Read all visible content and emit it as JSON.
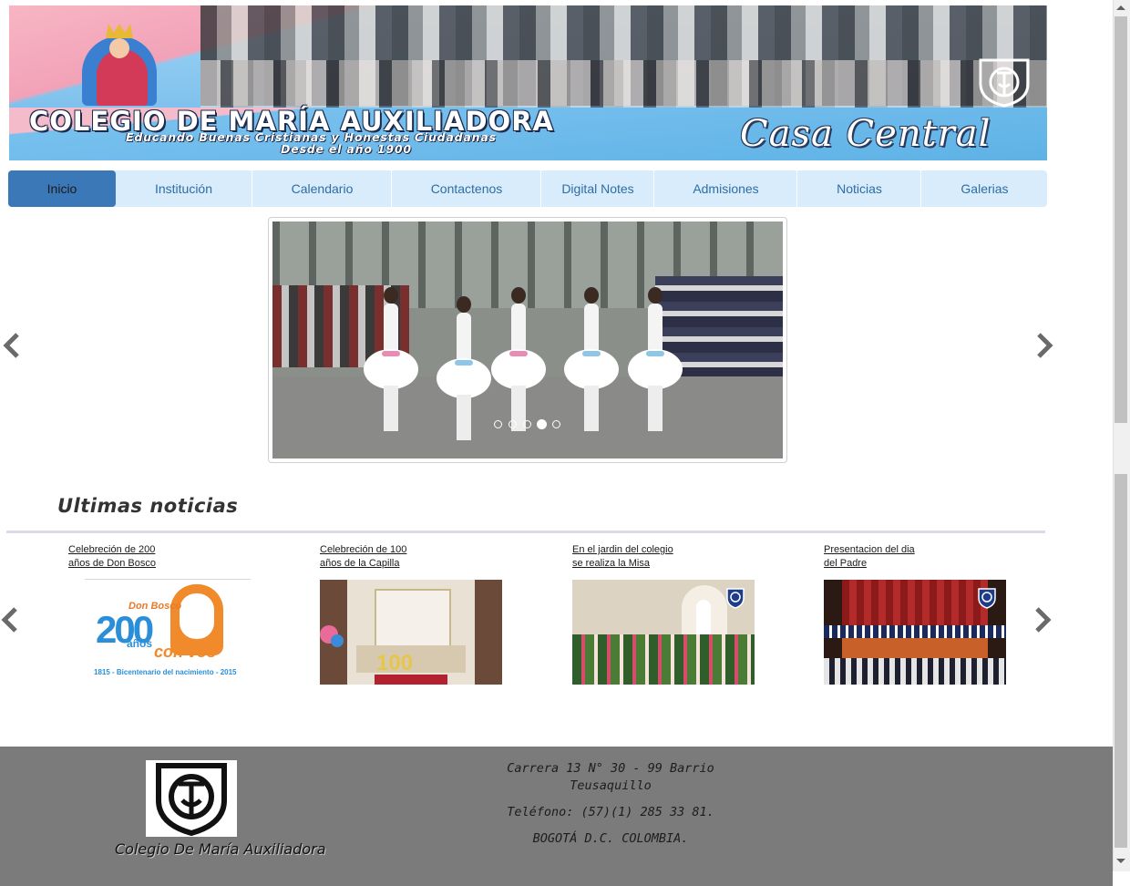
{
  "banner": {
    "title": "COLEGIO DE MARÍA AUXILIADORA",
    "tagline": "Educando Buenas Cristianas y  Honestas Ciudadanas",
    "since": "Desde el año 1900",
    "casa": "Casa Central"
  },
  "nav": {
    "items": [
      {
        "label": "Inicio",
        "active": true
      },
      {
        "label": "Institución"
      },
      {
        "label": "Calendario"
      },
      {
        "label": "Contactenos"
      },
      {
        "label": "Digital Notes"
      },
      {
        "label": "Admisiones"
      },
      {
        "label": "Noticias"
      },
      {
        "label": "Galerias"
      }
    ]
  },
  "slider": {
    "dot_count": 5,
    "active_dot": 4,
    "prev_icon": "chevron-left-icon",
    "next_icon": "chevron-right-icon"
  },
  "news": {
    "heading": "Ultimas noticias",
    "items": [
      {
        "line1": "Celebreción de 200",
        "line2": "años de Don Bosco",
        "image": "don-bosco-200-logo",
        "logo_top": "Don Bosco",
        "logo_num": "200",
        "logo_words": "años",
        "logo_con": "con vos",
        "logo_caption": "1815 - Bicentenario del nacimiento - 2015"
      },
      {
        "line1": "Celebreción de 100",
        "line2": "años de la Capilla",
        "image": "chapel-altar-photo",
        "badge": "100"
      },
      {
        "line1": "En el jardin del colegio",
        "line2": "se realiza la Misa",
        "image": "garden-statue-photo"
      },
      {
        "line1": "Presentacion del dia",
        "line2": "del Padre",
        "image": "stage-presentation-photo"
      }
    ]
  },
  "footer": {
    "school_name": "Colegio De María Auxiliadora",
    "address_line1": "Carrera 13 N° 30 - 99 Barrio",
    "address_line2": "Teusaquillo",
    "phone": "Teléfono: (57)(1) 285 33 81.",
    "city": "BOGOTÁ D.C. COLOMBIA."
  },
  "colors": {
    "nav_bg": "#d8ecfb",
    "nav_active": "#3b78b8",
    "nav_text": "#2e6da4",
    "footer_bg": "#7b7b7b"
  }
}
